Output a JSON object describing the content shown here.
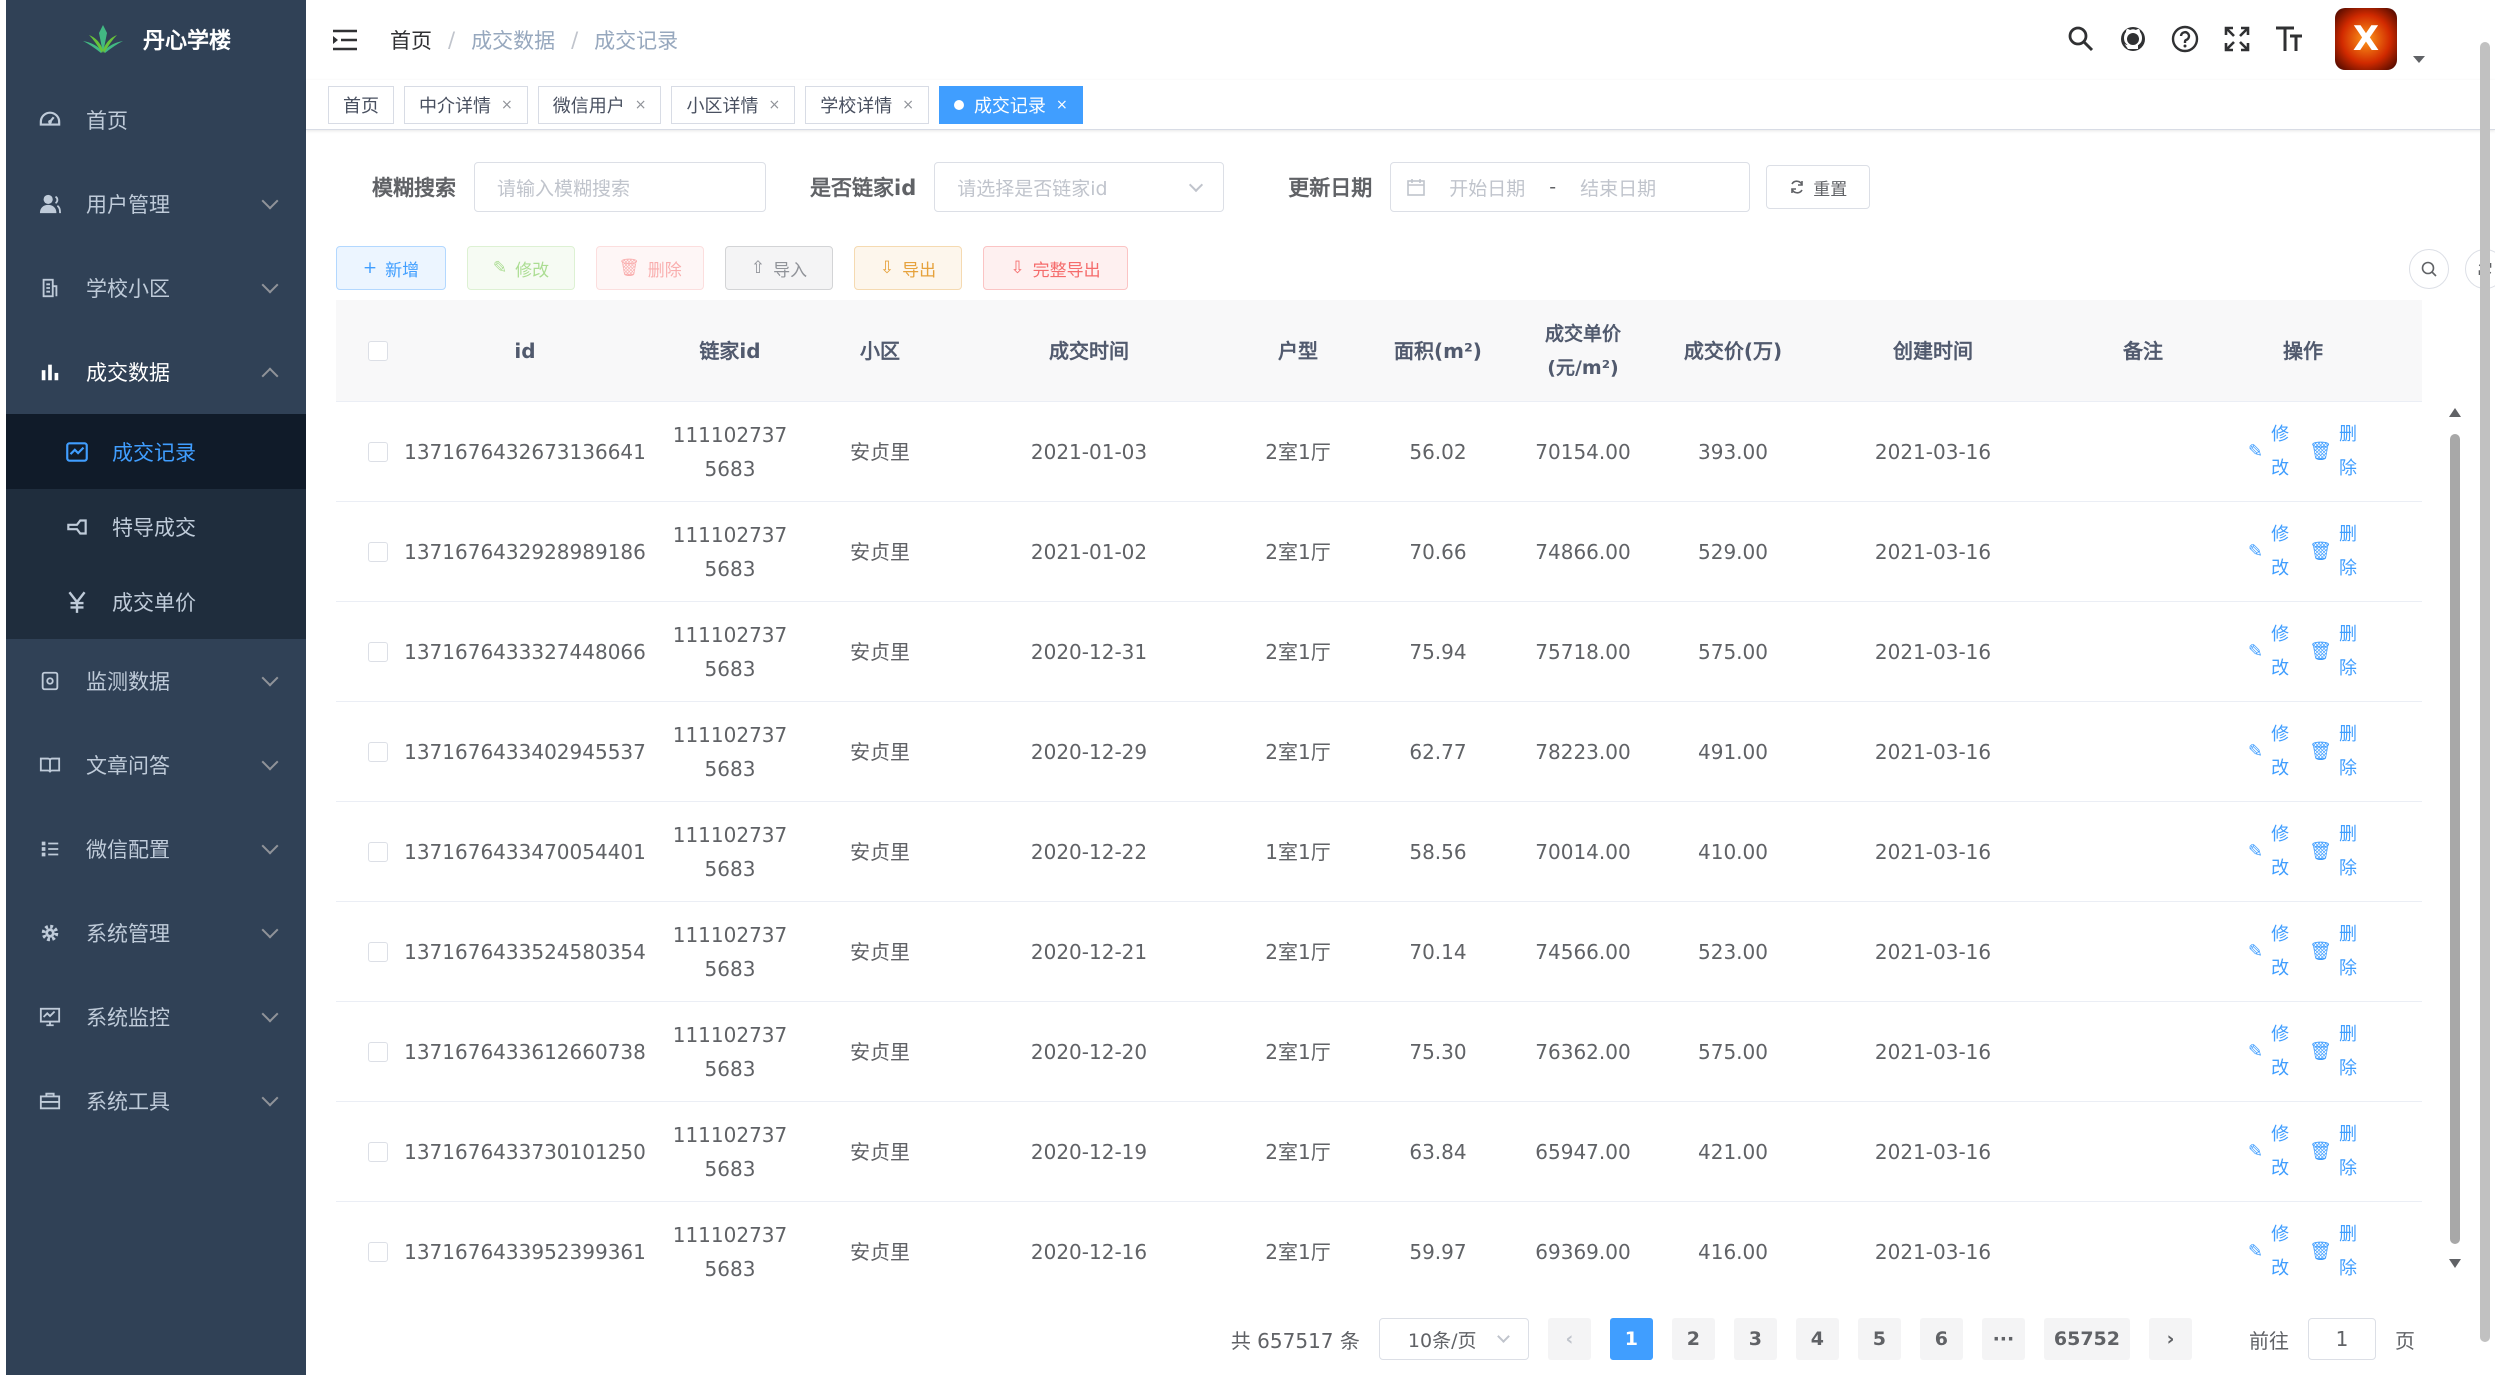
{
  "sidebar": {
    "logo_text": "丹心学楼",
    "menu": [
      {
        "label": "首页",
        "icon": "dashboard-icon",
        "has_arrow": false
      },
      {
        "label": "用户管理",
        "icon": "user-icon",
        "has_arrow": true
      },
      {
        "label": "学校小区",
        "icon": "school-icon",
        "has_arrow": true
      },
      {
        "label": "成交数据",
        "icon": "chart-icon",
        "has_arrow": true,
        "open": true
      }
    ],
    "submenu": [
      {
        "label": "成交记录",
        "icon": "record-icon",
        "active": true
      },
      {
        "label": "特导成交",
        "icon": "deal-icon"
      },
      {
        "label": "成交单价",
        "icon": "yuan-icon"
      }
    ],
    "menu_after": [
      {
        "label": "监测数据",
        "icon": "monitor-data-icon"
      },
      {
        "label": "文章问答",
        "icon": "book-icon"
      },
      {
        "label": "微信配置",
        "icon": "list-icon"
      },
      {
        "label": "系统管理",
        "icon": "gear-icon"
      },
      {
        "label": "系统监控",
        "icon": "monitor-icon"
      },
      {
        "label": "系统工具",
        "icon": "toolbox-icon"
      }
    ]
  },
  "breadcrumb": [
    "首页",
    "成交数据",
    "成交记录"
  ],
  "tags": [
    {
      "label": "首页",
      "closable": false,
      "active": false
    },
    {
      "label": "中介详情",
      "closable": true,
      "active": false
    },
    {
      "label": "微信用户",
      "closable": true,
      "active": false
    },
    {
      "label": "小区详情",
      "closable": true,
      "active": false
    },
    {
      "label": "学校详情",
      "closable": true,
      "active": false
    },
    {
      "label": "成交记录",
      "closable": true,
      "active": true
    }
  ],
  "tag_close": "×",
  "search": {
    "fuzzy_label": "模糊搜索",
    "fuzzy_placeholder": "请输入模糊搜索",
    "lianjia_label": "是否链家id",
    "lianjia_placeholder": "请选择是否链家id",
    "date_label": "更新日期",
    "start_placeholder": "开始日期",
    "date_sep": "-",
    "end_placeholder": "结束日期",
    "reset_label": "重置"
  },
  "toolbar": {
    "add": "新增",
    "edit": "修改",
    "delete": "删除",
    "import": "导入",
    "export": "导出",
    "full_export": "完整导出"
  },
  "table": {
    "headers": [
      "id",
      "链家id",
      "小区",
      "成交时间",
      "户型",
      "面积(m²)",
      "成交单价(元/m²)",
      "成交价(万)",
      "创建时间",
      "备注",
      "操作"
    ],
    "edit_label": "修改",
    "delete_label": "删除",
    "rows": [
      {
        "id": "1371676432673136641",
        "lianjia": "1111027375683",
        "community": "安贞里",
        "date": "2021-01-03",
        "layout": "2室1厅",
        "area": "56.02",
        "unit_price": "70154.00",
        "price": "393.00",
        "created": "2021-03-16",
        "note": ""
      },
      {
        "id": "1371676432928989186",
        "lianjia": "1111027375683",
        "community": "安贞里",
        "date": "2021-01-02",
        "layout": "2室1厅",
        "area": "70.66",
        "unit_price": "74866.00",
        "price": "529.00",
        "created": "2021-03-16",
        "note": ""
      },
      {
        "id": "1371676433327448066",
        "lianjia": "1111027375683",
        "community": "安贞里",
        "date": "2020-12-31",
        "layout": "2室1厅",
        "area": "75.94",
        "unit_price": "75718.00",
        "price": "575.00",
        "created": "2021-03-16",
        "note": ""
      },
      {
        "id": "1371676433402945537",
        "lianjia": "1111027375683",
        "community": "安贞里",
        "date": "2020-12-29",
        "layout": "2室1厅",
        "area": "62.77",
        "unit_price": "78223.00",
        "price": "491.00",
        "created": "2021-03-16",
        "note": ""
      },
      {
        "id": "1371676433470054401",
        "lianjia": "1111027375683",
        "community": "安贞里",
        "date": "2020-12-22",
        "layout": "1室1厅",
        "area": "58.56",
        "unit_price": "70014.00",
        "price": "410.00",
        "created": "2021-03-16",
        "note": ""
      },
      {
        "id": "1371676433524580354",
        "lianjia": "1111027375683",
        "community": "安贞里",
        "date": "2020-12-21",
        "layout": "2室1厅",
        "area": "70.14",
        "unit_price": "74566.00",
        "price": "523.00",
        "created": "2021-03-16",
        "note": ""
      },
      {
        "id": "1371676433612660738",
        "lianjia": "1111027375683",
        "community": "安贞里",
        "date": "2020-12-20",
        "layout": "2室1厅",
        "area": "75.30",
        "unit_price": "76362.00",
        "price": "575.00",
        "created": "2021-03-16",
        "note": ""
      },
      {
        "id": "1371676433730101250",
        "lianjia": "1111027375683",
        "community": "安贞里",
        "date": "2020-12-19",
        "layout": "2室1厅",
        "area": "63.84",
        "unit_price": "65947.00",
        "price": "421.00",
        "created": "2021-03-16",
        "note": ""
      },
      {
        "id": "1371676433952399361",
        "lianjia": "1111027375683",
        "community": "安贞里",
        "date": "2020-12-16",
        "layout": "2室1厅",
        "area": "59.97",
        "unit_price": "69369.00",
        "price": "416.00",
        "created": "2021-03-16",
        "note": ""
      }
    ]
  },
  "pagination": {
    "total_text": "共 657517 条",
    "page_size": "10条/页",
    "pages": [
      "1",
      "2",
      "3",
      "4",
      "5",
      "6"
    ],
    "ellipsis": "···",
    "last_page": "65752",
    "current": "1",
    "goto_prefix": "前往",
    "goto_value": "1",
    "goto_suffix": "页"
  },
  "colors": {
    "sidebar_bg": "#304156",
    "primary": "#409eff",
    "danger": "#f56c6c",
    "success": "#67c23a",
    "warning": "#e6a23c"
  }
}
